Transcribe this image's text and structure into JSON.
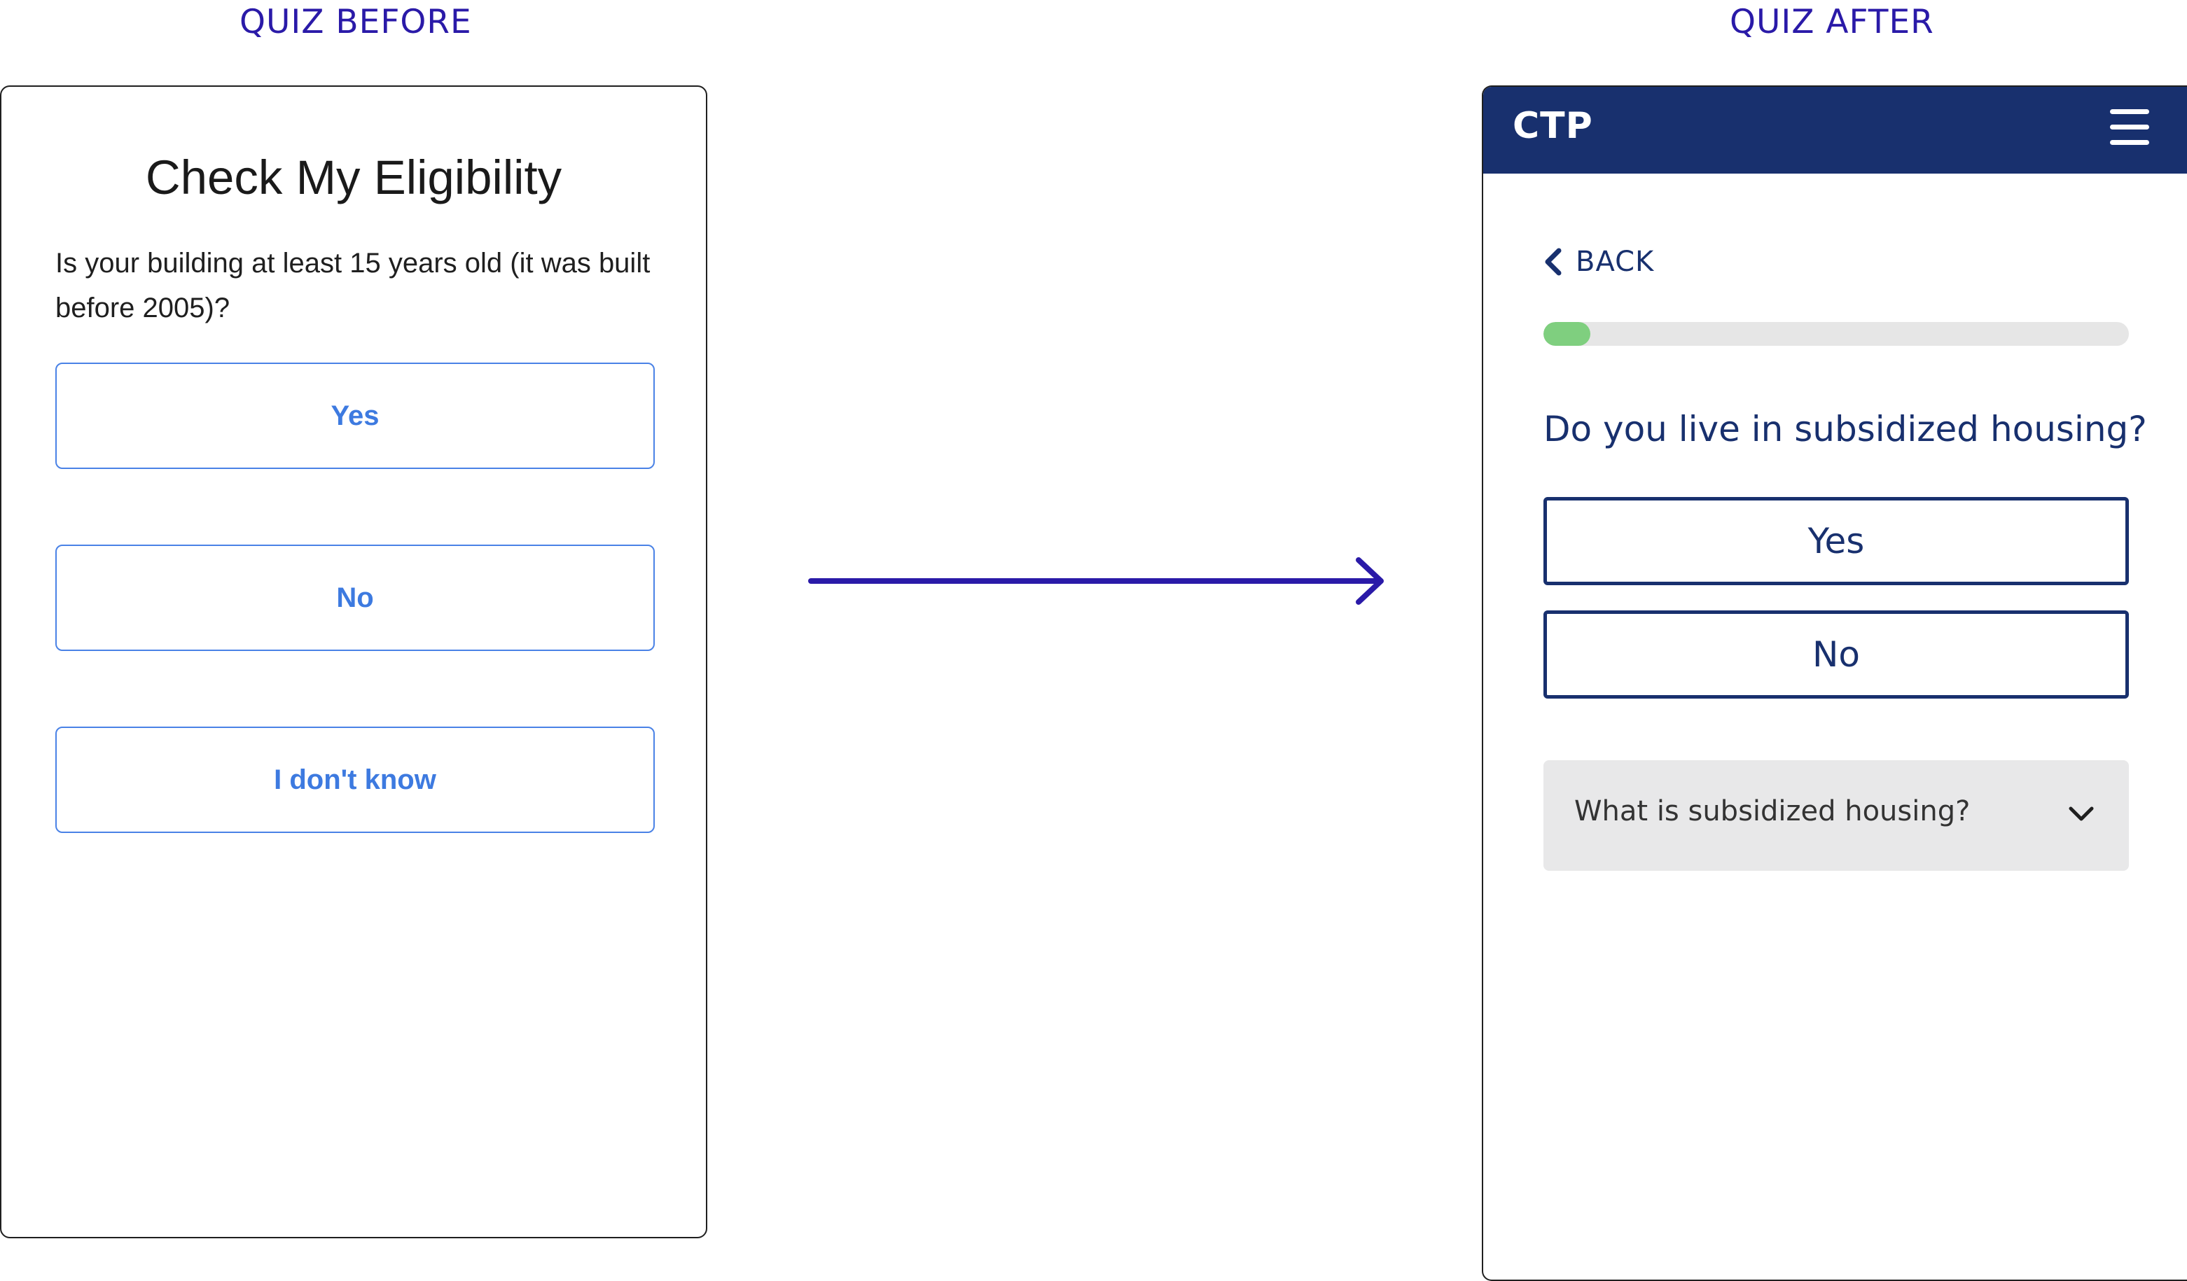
{
  "captions": {
    "before": "QUIZ BEFORE",
    "after": "QUIZ AFTER"
  },
  "before": {
    "title": "Check My Eligibility",
    "question": "Is your building at least 15 years old (it was built before 2005)?",
    "options": [
      "Yes",
      "No",
      "I don't know"
    ],
    "colors": {
      "button_border": "#4a82e6",
      "button_text": "#3d7ae0"
    }
  },
  "arrow": {
    "icon": "right-arrow-icon",
    "color": "#2a1aa8"
  },
  "after": {
    "header": {
      "brand": "CTP",
      "menu_icon": "hamburger-menu-icon",
      "background": "#18306e"
    },
    "back": {
      "icon": "chevron-left-icon",
      "label": "BACK"
    },
    "progress": {
      "fraction": 0.08,
      "fill_color": "#7fcf7f"
    },
    "question": "Do you live in subsidized housing?",
    "options": [
      "Yes",
      "No"
    ],
    "accordion": {
      "label": "What is subsidized housing?",
      "icon": "chevron-down-icon",
      "expanded": false
    }
  }
}
